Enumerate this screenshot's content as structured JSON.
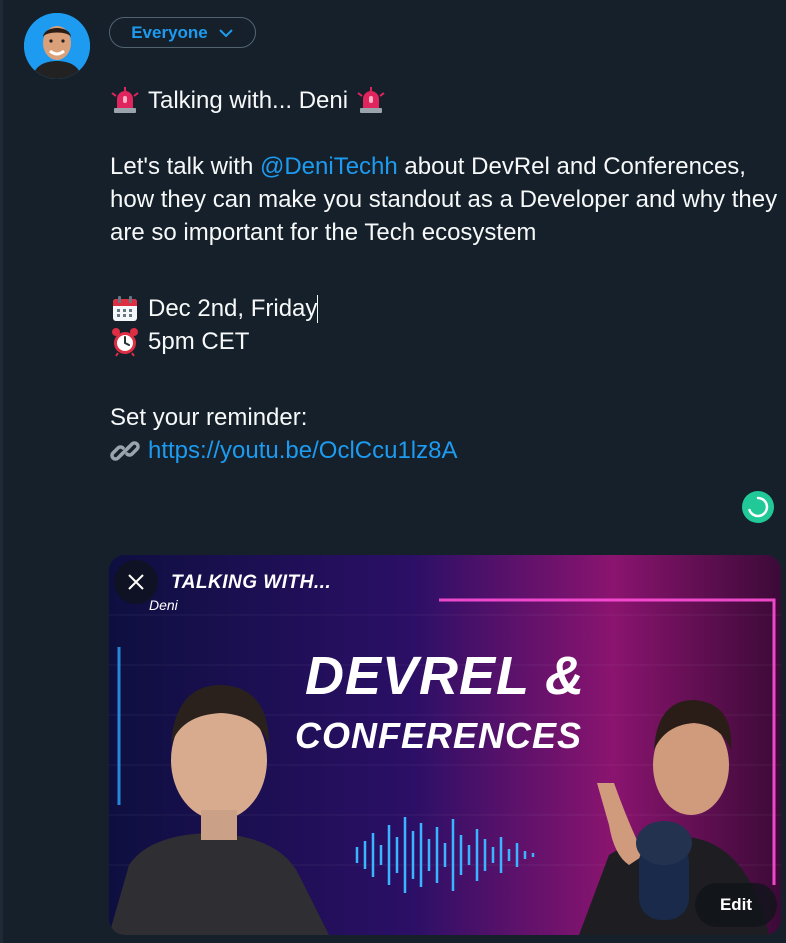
{
  "composer": {
    "audience_label": "Everyone",
    "lines": {
      "title": "Talking with... Deni",
      "intro_before": "Let's talk with ",
      "mention": "@DeniTechh",
      "intro_after": " about DevRel and Conferences, how they can make you standout as a Developer and why they are so important for the Tech ecosystem",
      "date": "Dec 2nd, Friday",
      "time": "5pm CET",
      "reminder": "Set your reminder:",
      "url": "https://youtu.be/OclCcu1lz8A"
    },
    "icons": {
      "title_left": "siren-icon",
      "title_right": "siren-icon",
      "date": "calendar-icon",
      "time": "alarm-clock-icon",
      "url": "link-icon"
    },
    "progress_color": "#20c997"
  },
  "media": {
    "thumbnail_text": {
      "series": "TALKING WITH...",
      "guest": "Deni",
      "headline_1": "DEVREL &",
      "headline_2": "CONFERENCES"
    },
    "edit_label": "Edit"
  },
  "colors": {
    "background": "#15202b",
    "accent": "#1d9bf0",
    "text": "#f7f9f9"
  }
}
